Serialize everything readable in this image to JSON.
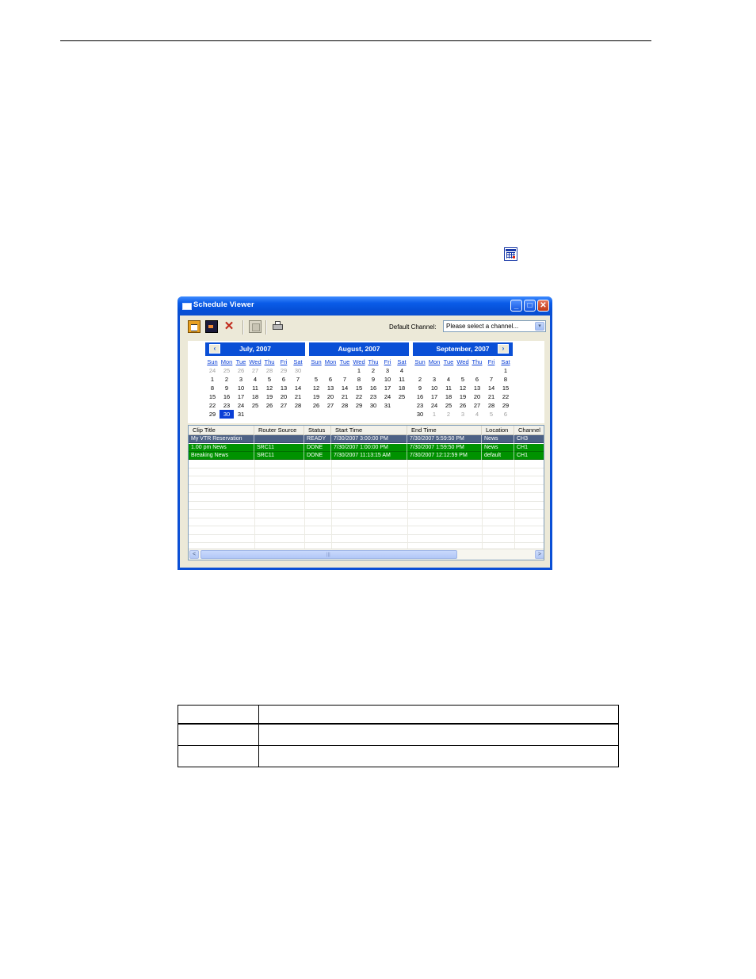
{
  "window": {
    "title": "Schedule Viewer",
    "minimize_glyph": "_",
    "maximize_glyph": "□",
    "close_glyph": "✕"
  },
  "toolbar": {
    "delete_glyph": "✕",
    "default_channel_label": "Default Channel:",
    "channel_select_value": "Please select a channel...",
    "dropdown_glyph": "▾"
  },
  "calendars": [
    {
      "title": "July, 2007",
      "nav": "‹",
      "dow": [
        "Sun",
        "Mon",
        "Tue",
        "Wed",
        "Thu",
        "Fri",
        "Sat"
      ],
      "weeks": [
        [
          [
            "24",
            1
          ],
          [
            "25",
            1
          ],
          [
            "26",
            1
          ],
          [
            "27",
            1
          ],
          [
            "28",
            1
          ],
          [
            "29",
            1
          ],
          [
            "30",
            1
          ]
        ],
        [
          [
            "1",
            0
          ],
          [
            "2",
            0
          ],
          [
            "3",
            0
          ],
          [
            "4",
            0
          ],
          [
            "5",
            0
          ],
          [
            "6",
            0
          ],
          [
            "7",
            0
          ]
        ],
        [
          [
            "8",
            0
          ],
          [
            "9",
            0
          ],
          [
            "10",
            0
          ],
          [
            "11",
            0
          ],
          [
            "12",
            0
          ],
          [
            "13",
            0
          ],
          [
            "14",
            0
          ]
        ],
        [
          [
            "15",
            0
          ],
          [
            "16",
            0
          ],
          [
            "17",
            0
          ],
          [
            "18",
            0
          ],
          [
            "19",
            0
          ],
          [
            "20",
            0
          ],
          [
            "21",
            0
          ]
        ],
        [
          [
            "22",
            0
          ],
          [
            "23",
            0
          ],
          [
            "24",
            0
          ],
          [
            "25",
            0
          ],
          [
            "26",
            0
          ],
          [
            "27",
            0
          ],
          [
            "28",
            0
          ]
        ],
        [
          [
            "29",
            0
          ],
          [
            "30",
            2
          ],
          [
            "31",
            0
          ],
          [
            "",
            0
          ],
          [
            "",
            0
          ],
          [
            "",
            0
          ],
          [
            "",
            0
          ]
        ]
      ]
    },
    {
      "title": "August, 2007",
      "nav": "",
      "dow": [
        "Sun",
        "Mon",
        "Tue",
        "Wed",
        "Thu",
        "Fri",
        "Sat"
      ],
      "weeks": [
        [
          [
            "",
            0
          ],
          [
            "",
            0
          ],
          [
            "",
            0
          ],
          [
            "1",
            0
          ],
          [
            "2",
            0
          ],
          [
            "3",
            0
          ],
          [
            "4",
            0
          ]
        ],
        [
          [
            "5",
            0
          ],
          [
            "6",
            0
          ],
          [
            "7",
            0
          ],
          [
            "8",
            0
          ],
          [
            "9",
            0
          ],
          [
            "10",
            0
          ],
          [
            "11",
            0
          ]
        ],
        [
          [
            "12",
            0
          ],
          [
            "13",
            0
          ],
          [
            "14",
            0
          ],
          [
            "15",
            0
          ],
          [
            "16",
            0
          ],
          [
            "17",
            0
          ],
          [
            "18",
            0
          ]
        ],
        [
          [
            "19",
            0
          ],
          [
            "20",
            0
          ],
          [
            "21",
            0
          ],
          [
            "22",
            0
          ],
          [
            "23",
            0
          ],
          [
            "24",
            0
          ],
          [
            "25",
            0
          ]
        ],
        [
          [
            "26",
            0
          ],
          [
            "27",
            0
          ],
          [
            "28",
            0
          ],
          [
            "29",
            0
          ],
          [
            "30",
            0
          ],
          [
            "31",
            0
          ],
          [
            "",
            0
          ]
        ],
        [
          [
            "",
            0
          ],
          [
            "",
            0
          ],
          [
            "",
            0
          ],
          [
            "",
            0
          ],
          [
            "",
            0
          ],
          [
            "",
            0
          ],
          [
            "",
            0
          ]
        ]
      ]
    },
    {
      "title": "September, 2007",
      "nav": "›",
      "dow": [
        "Sun",
        "Mon",
        "Tue",
        "Wed",
        "Thu",
        "Fri",
        "Sat"
      ],
      "weeks": [
        [
          [
            "",
            0
          ],
          [
            "",
            0
          ],
          [
            "",
            0
          ],
          [
            "",
            0
          ],
          [
            "",
            0
          ],
          [
            "",
            0
          ],
          [
            "1",
            0
          ]
        ],
        [
          [
            "2",
            0
          ],
          [
            "3",
            0
          ],
          [
            "4",
            0
          ],
          [
            "5",
            0
          ],
          [
            "6",
            0
          ],
          [
            "7",
            0
          ],
          [
            "8",
            0
          ]
        ],
        [
          [
            "9",
            0
          ],
          [
            "10",
            0
          ],
          [
            "11",
            0
          ],
          [
            "12",
            0
          ],
          [
            "13",
            0
          ],
          [
            "14",
            0
          ],
          [
            "15",
            0
          ]
        ],
        [
          [
            "16",
            0
          ],
          [
            "17",
            0
          ],
          [
            "18",
            0
          ],
          [
            "19",
            0
          ],
          [
            "20",
            0
          ],
          [
            "21",
            0
          ],
          [
            "22",
            0
          ]
        ],
        [
          [
            "23",
            0
          ],
          [
            "24",
            0
          ],
          [
            "25",
            0
          ],
          [
            "26",
            0
          ],
          [
            "27",
            0
          ],
          [
            "28",
            0
          ],
          [
            "29",
            0
          ]
        ],
        [
          [
            "30",
            0
          ],
          [
            "1",
            1
          ],
          [
            "2",
            1
          ],
          [
            "3",
            1
          ],
          [
            "4",
            1
          ],
          [
            "5",
            1
          ],
          [
            "6",
            1
          ]
        ]
      ]
    }
  ],
  "grid": {
    "columns": [
      "Clip Title",
      "Router Source",
      "Status",
      "Start Time",
      "End Time",
      "Location",
      "Channel"
    ],
    "rows": [
      {
        "style": "blue",
        "cells": [
          "My VTR Reservation",
          "",
          "READY",
          "7/30/2007 3:00:00 PM",
          "7/30/2007 5:59:50 PM",
          "News",
          "CH3"
        ]
      },
      {
        "style": "green",
        "cells": [
          "1.00 pm News",
          "SRC11",
          "DONE",
          "7/30/2007 1:00:00 PM",
          "7/30/2007 1:59:50 PM",
          "News",
          "CH1"
        ]
      },
      {
        "style": "green",
        "cells": [
          "Breaking News",
          "SRC11",
          "DONE",
          "7/30/2007 11:13:15 AM",
          "7/30/2007 12:12:59 PM",
          "default",
          "CH1"
        ]
      }
    ],
    "empty_rows": 11,
    "scroll_left_glyph": "<",
    "scroll_right_glyph": ">",
    "scroll_grip": "|||"
  },
  "icons": [
    "calendar-view-icon",
    "app-window-icon",
    "new-record-icon",
    "edit-record-icon",
    "delete-icon",
    "stop-icon",
    "print-icon"
  ]
}
